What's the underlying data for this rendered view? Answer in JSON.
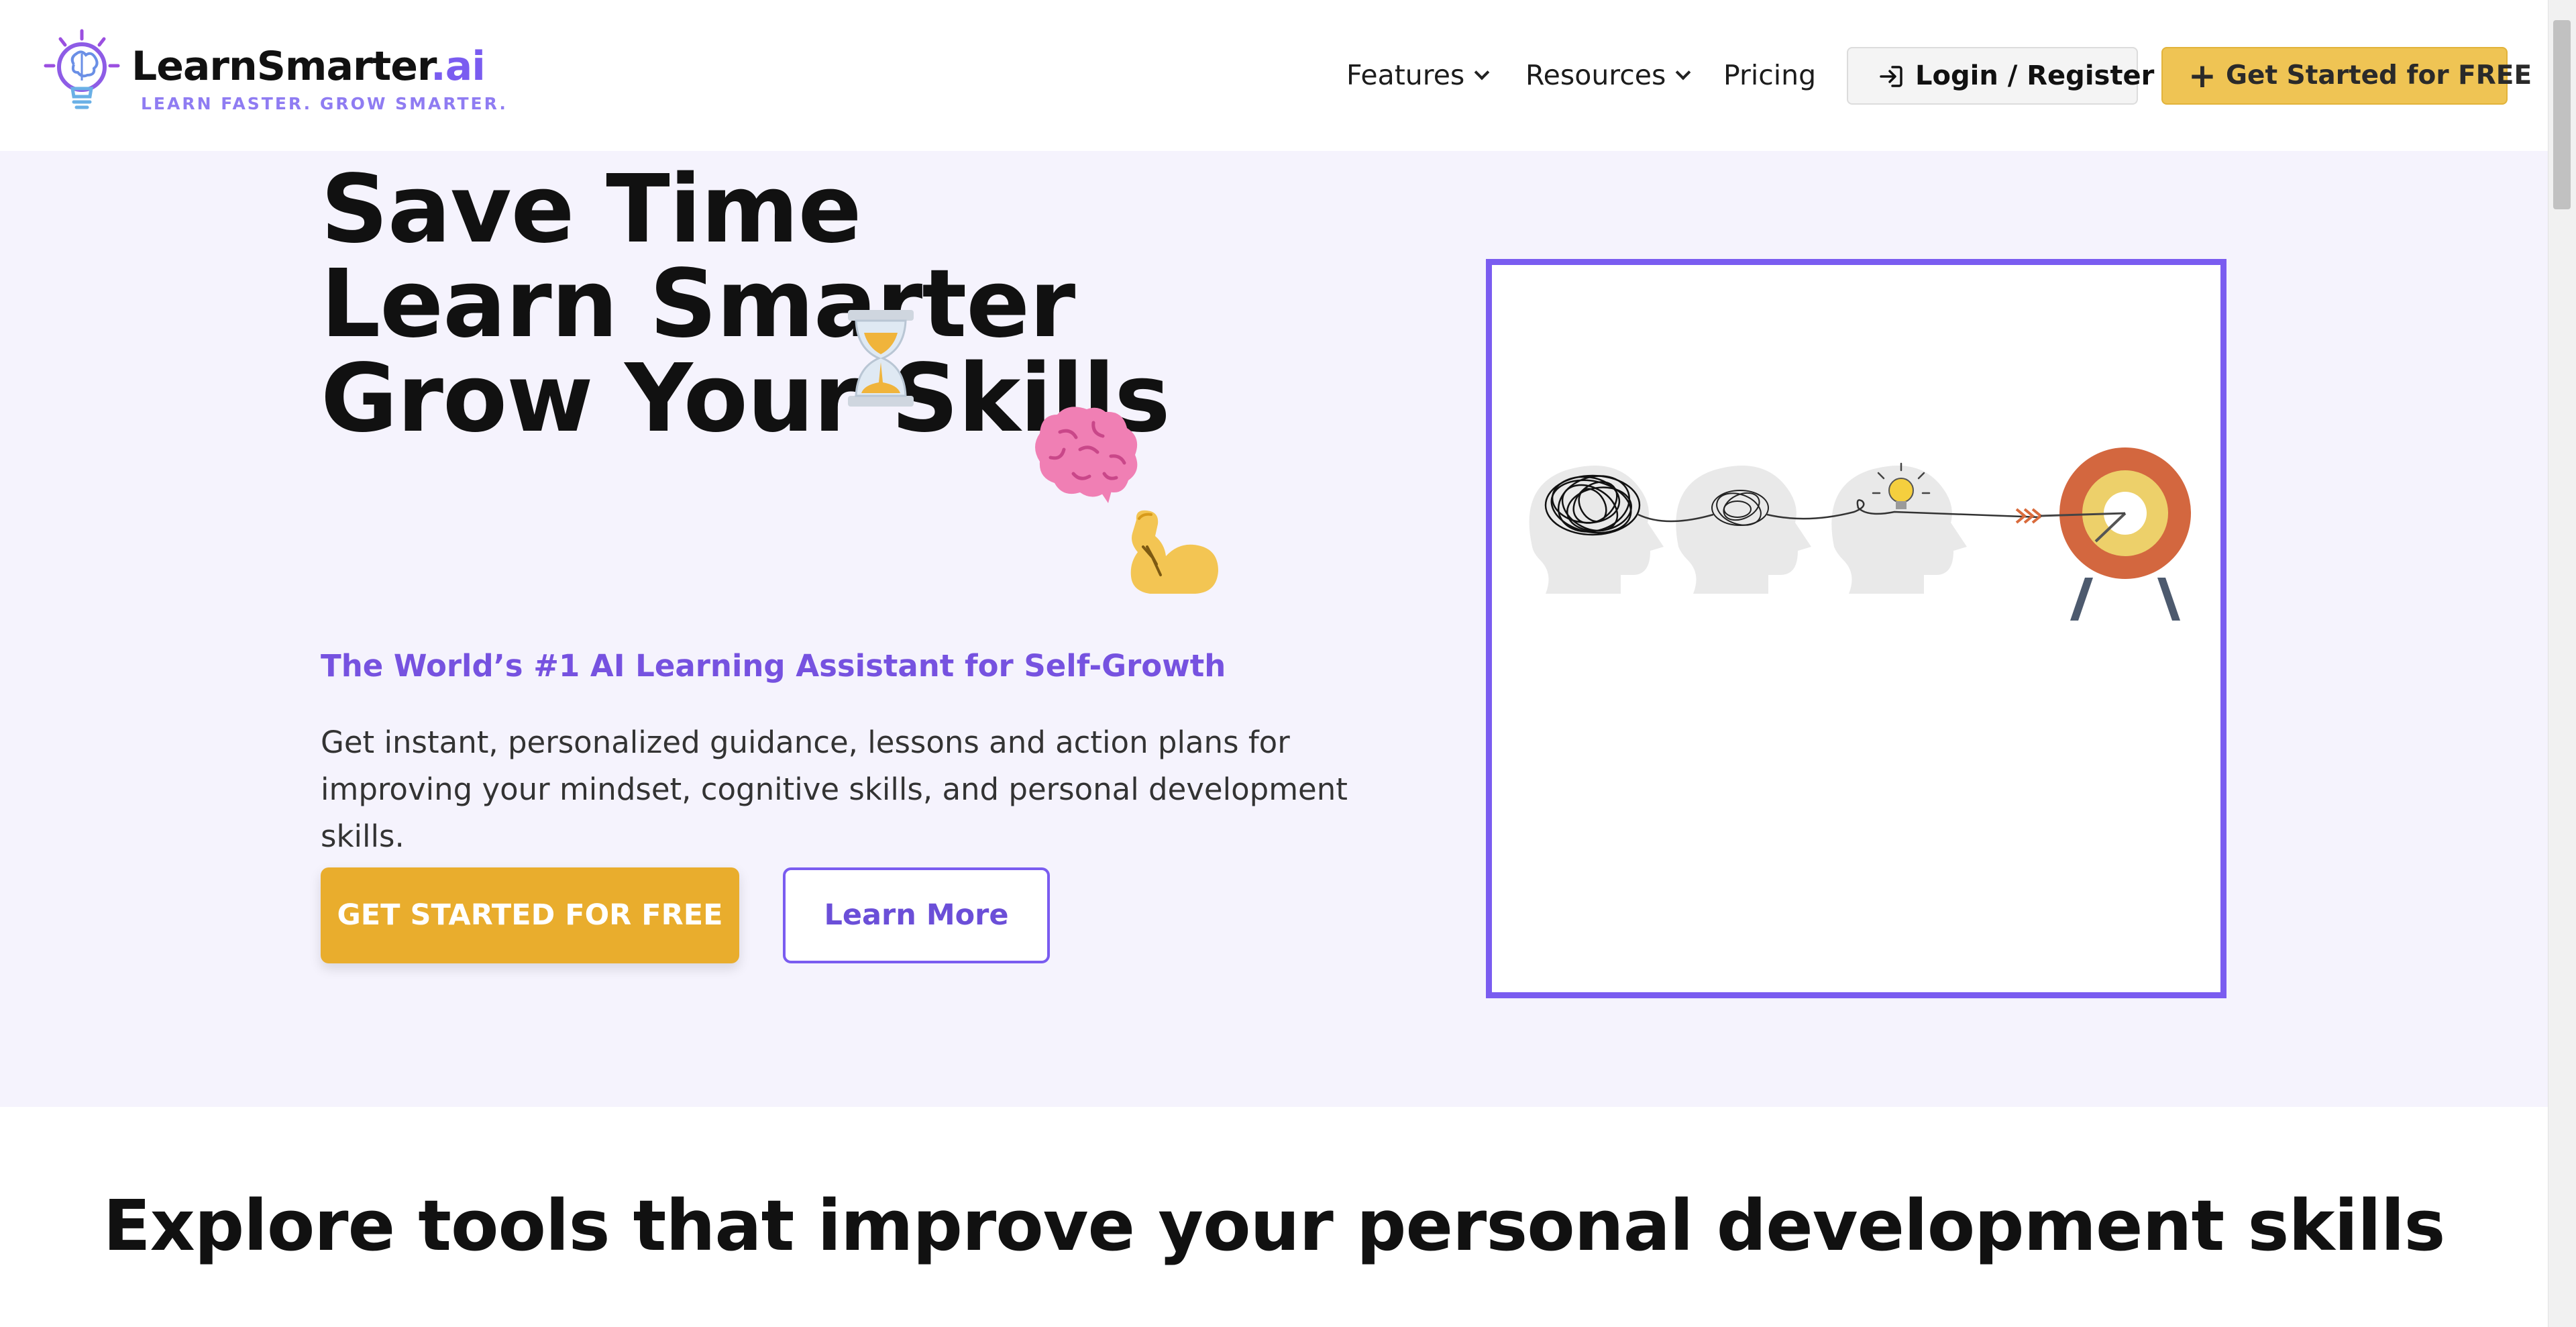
{
  "brand": {
    "name_main": "LearnSmarter",
    "name_suffix": ".ai",
    "tagline": "LEARN FASTER. GROW SMARTER."
  },
  "nav": {
    "features": "Features",
    "resources": "Resources",
    "pricing": "Pricing",
    "login": "Login / Register",
    "get_started": "Get Started for FREE"
  },
  "hero": {
    "line1": "Save Time",
    "line2": "Learn Smarter",
    "line3": "Grow Your Skills",
    "subheadline": "The World’s #1 AI Learning Assistant for Self-Growth",
    "description": "Get instant, personalized guidance, lessons and action plans for improving your mindset, cognitive skills, and personal development skills.",
    "cta_primary": "GET STARTED FOR FREE",
    "cta_secondary": "Learn More"
  },
  "section": {
    "title": "Explore tools that improve your personal development skills"
  },
  "colors": {
    "accent": "#7a5cf0",
    "cta_gold": "#e9ad2d",
    "header_button_gold": "#efc454",
    "hero_background": "#f5f3fd"
  },
  "icons": [
    "lightbulb-brain-logo-icon",
    "chevron-down-icon",
    "login-arrow-icon",
    "plus-icon",
    "hourglass-icon",
    "brain-icon",
    "flexed-biceps-icon",
    "target-arrow-illustration"
  ]
}
